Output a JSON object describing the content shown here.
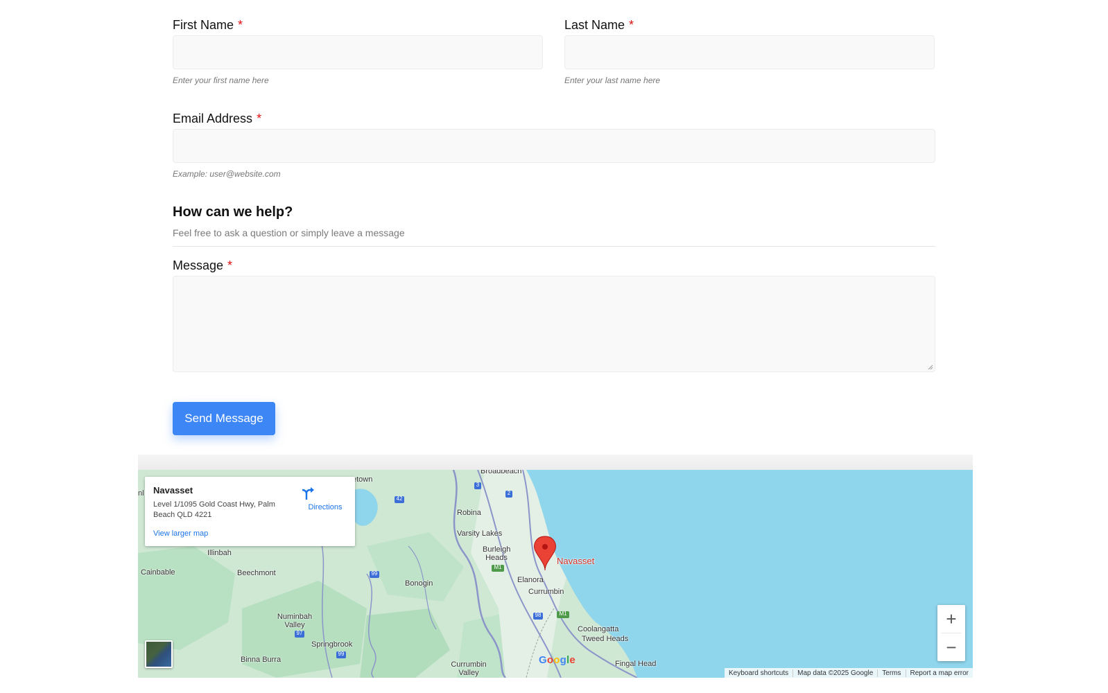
{
  "form": {
    "first_name": {
      "label": "First Name",
      "required_mark": "*",
      "value": "",
      "hint": "Enter your first name here"
    },
    "last_name": {
      "label": "Last Name",
      "required_mark": "*",
      "value": "",
      "hint": "Enter your last name here"
    },
    "email": {
      "label": "Email Address",
      "required_mark": "*",
      "value": "",
      "hint": "Example: user@website.com"
    },
    "section": {
      "title": "How can we help?",
      "subtitle": "Feel free to ask a question or simply leave a message"
    },
    "message": {
      "label": "Message",
      "required_mark": "*",
      "value": ""
    },
    "submit_label": "Send Message"
  },
  "map": {
    "info_card": {
      "name": "Navasset",
      "address": "Level 1/1095 Gold Coast Hwy, Palm Beach QLD 4221",
      "directions_label": "Directions",
      "larger_map_label": "View larger map"
    },
    "pin_label": "Navasset",
    "places": [
      "Broadbeach",
      "etown",
      "Robina",
      "Varsity Lakes",
      "Burleigh Heads",
      "Elanora",
      "Currumbin",
      "Illinbah",
      "Cainbable",
      "Beechmont",
      "Bonogin",
      "Numinbah Valley",
      "Springbrook",
      "Binna Burra",
      "Currumbin Valley",
      "Coolangatta",
      "Tweed Heads",
      "Fingal Head",
      "nl"
    ],
    "road_shields": [
      "3",
      "2",
      "42",
      "M1",
      "99",
      "98",
      "M1",
      "97",
      "99"
    ],
    "zoom_in_label": "+",
    "zoom_out_label": "−",
    "google_logo": "Google",
    "attribution": [
      "Keyboard shortcuts",
      "Map data ©2025 Google",
      "Terms",
      "Report a map error"
    ],
    "colors": {
      "land": "#cfe8d4",
      "water": "#8fd5ec",
      "forest": "#b8e0c2",
      "road": "#8b95c9",
      "pin": "#ea4335",
      "accent": "#3d86f6"
    }
  }
}
